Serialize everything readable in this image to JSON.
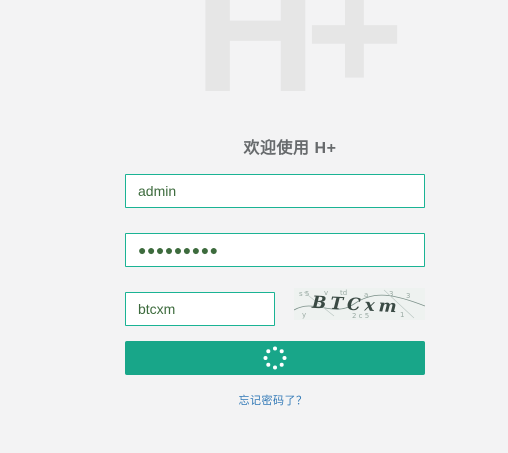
{
  "logo": {
    "text": "H+"
  },
  "welcome": {
    "text": "欢迎使用 H+"
  },
  "form": {
    "username_value": "admin",
    "password_mask": "●●●●●●●●●",
    "captcha_value": "btcxm"
  },
  "captcha": {
    "text": "BTCxm"
  },
  "forgot": {
    "text": "忘记密码了？"
  },
  "colors": {
    "accent": "#1ab394",
    "button": "#18a689",
    "background": "#f3f3f4",
    "link": "#337ab7"
  },
  "icons": {
    "submit": "loading-spinner-icon"
  }
}
